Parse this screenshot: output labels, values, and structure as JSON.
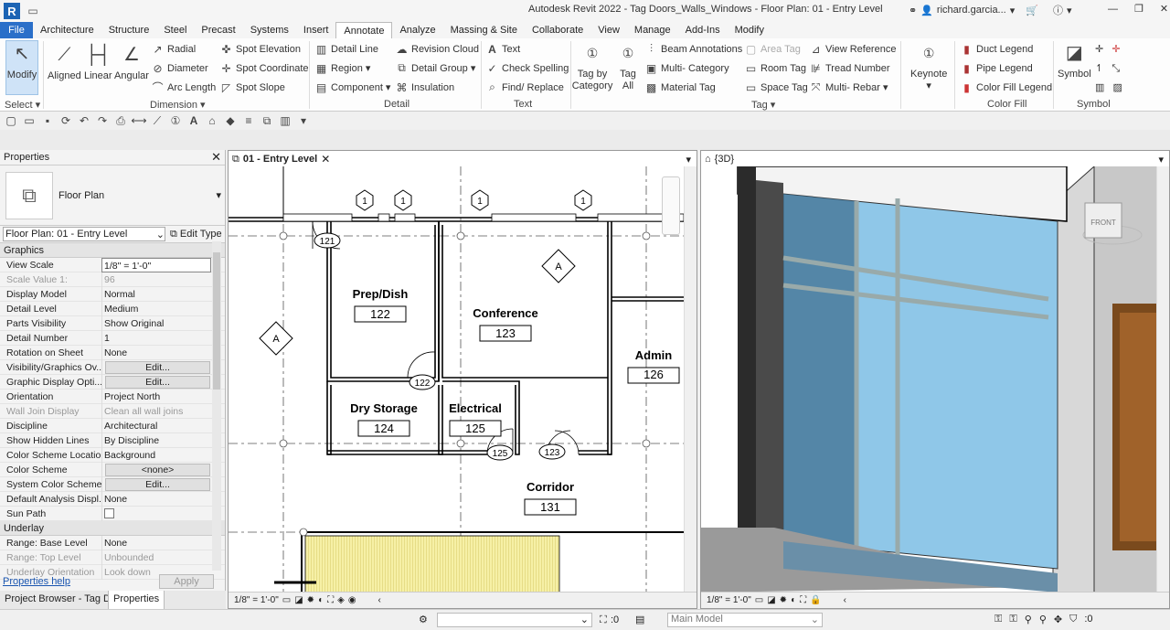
{
  "app": {
    "title": "Autodesk Revit 2022 - Tag Doors_Walls_Windows - Floor Plan: 01 - Entry Level",
    "logo": "R",
    "user": "richard.garcia..."
  },
  "menu_tabs": [
    "File",
    "Architecture",
    "Structure",
    "Steel",
    "Precast",
    "Systems",
    "Insert",
    "Annotate",
    "Analyze",
    "Massing & Site",
    "Collaborate",
    "View",
    "Manage",
    "Add-Ins",
    "Modify"
  ],
  "ribbon": {
    "modify": "Modify",
    "select": "Select",
    "dimension": {
      "aligned": "Aligned",
      "linear": "Linear",
      "angular": "Angular",
      "radial": "Radial",
      "diameter": "Diameter",
      "arc_length": "Arc  Length",
      "spot_elevation": "Spot  Elevation",
      "spot_coordinate": "Spot  Coordinate",
      "spot_slope": "Spot  Slope",
      "group": "Dimension"
    },
    "detail": {
      "detail_line": "Detail  Line",
      "region": "Region",
      "component": "Component",
      "revision_cloud": "Revision  Cloud",
      "detail_group": "Detail  Group",
      "insulation": "Insulation",
      "group": "Detail"
    },
    "text": {
      "text": "Text",
      "check_spelling": "Check  Spelling",
      "find_replace": "Find/  Replace",
      "group": "Text"
    },
    "tag": {
      "tag_by_category": "Tag by\nCategory",
      "tag_all": "Tag\nAll",
      "beam_annotations": "Beam  Annotations",
      "multi_category": "Multi-  Category",
      "material_tag": "Material  Tag",
      "area_tag": "Area  Tag",
      "room_tag": "Room  Tag",
      "space_tag": "Space  Tag",
      "view_reference": "View  Reference",
      "tread_number": "Tread  Number",
      "multi_rebar": "Multi-  Rebar",
      "group": "Tag"
    },
    "keynote": "Keynote",
    "color_fill": {
      "duct_legend": "Duct  Legend",
      "pipe_legend": "Pipe  Legend",
      "color_fill_legend": "Color Fill  Legend",
      "group": "Color Fill"
    },
    "symbol": {
      "symbol": "Symbol",
      "group": "Symbol"
    }
  },
  "properties": {
    "title": "Properties",
    "type": "Floor Plan",
    "instance": "Floor Plan: 01 - Entry Level",
    "edit_type": "Edit Type",
    "section_graphics": "Graphics",
    "rows": [
      {
        "k": "View Scale",
        "v": "1/8\" = 1'-0\""
      },
      {
        "k": "Scale Value    1:",
        "v": "96",
        "dis": true
      },
      {
        "k": "Display Model",
        "v": "Normal"
      },
      {
        "k": "Detail Level",
        "v": "Medium"
      },
      {
        "k": "Parts Visibility",
        "v": "Show Original"
      },
      {
        "k": "Detail Number",
        "v": "1"
      },
      {
        "k": "Rotation on Sheet",
        "v": "None"
      },
      {
        "k": "Visibility/Graphics Ov...",
        "v": "Edit...",
        "btn": true
      },
      {
        "k": "Graphic Display Opti...",
        "v": "Edit...",
        "btn": true
      },
      {
        "k": "Orientation",
        "v": "Project North"
      },
      {
        "k": "Wall Join Display",
        "v": "Clean all wall joins",
        "dis": true
      },
      {
        "k": "Discipline",
        "v": "Architectural"
      },
      {
        "k": "Show Hidden Lines",
        "v": "By Discipline"
      },
      {
        "k": "Color Scheme Location",
        "v": "Background"
      },
      {
        "k": "Color Scheme",
        "v": "<none>",
        "btn": true
      },
      {
        "k": "System Color Schemes",
        "v": "Edit...",
        "btn": true
      },
      {
        "k": "Default Analysis Displ...",
        "v": "None"
      },
      {
        "k": "Sun Path",
        "v": ""
      }
    ],
    "section_underlay": "Underlay",
    "underlay_rows": [
      {
        "k": "Range: Base Level",
        "v": "None"
      },
      {
        "k": "Range: Top Level",
        "v": "Unbounded",
        "dis": true
      },
      {
        "k": "Underlay Orientation",
        "v": "Look down",
        "dis": true
      }
    ],
    "help": "Properties help",
    "apply": "Apply"
  },
  "bottom_tabs": [
    "Project Browser - Tag D...",
    "Properties"
  ],
  "plan_view": {
    "tab": "01 - Entry Level",
    "scale": "1/8\" = 1'-0\"",
    "rooms": [
      {
        "name": "Prep/Dish",
        "num": "122"
      },
      {
        "name": "Conference",
        "num": "123"
      },
      {
        "name": "Admin",
        "num": "126"
      },
      {
        "name": "Dry Storage",
        "num": "124"
      },
      {
        "name": "Electrical",
        "num": "125"
      },
      {
        "name": "Corridor",
        "num": "131"
      }
    ],
    "door_tags": [
      "121",
      "122",
      "125",
      "123"
    ],
    "window_tag": "1",
    "grid_tag": "A"
  },
  "view3d": {
    "tab": "{3D}",
    "scale": "1/8\" = 1'-0\"",
    "viewcube": "FRONT"
  },
  "status": {
    "zero1": ":0",
    "workset": "Main Model",
    "zero2": ":0"
  },
  "colors": {
    "file_tab": "#2a6fc9",
    "accent": "#1c64b4",
    "glass": "#8fc7e8",
    "hatch": "#f6f0a6"
  }
}
